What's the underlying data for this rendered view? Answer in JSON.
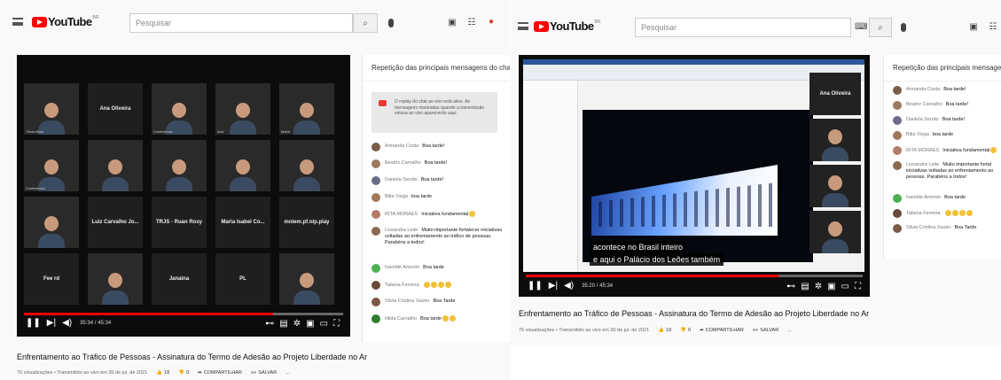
{
  "left": {
    "topbar": {
      "logo_text": "YouTube",
      "logo_sup": "BR",
      "search_placeholder": "Pesquisar"
    },
    "tiles": [
      {
        "name": "",
        "label": "Tânia Mara"
      },
      {
        "name": "Ana Oliveira",
        "label": ""
      },
      {
        "name": "",
        "label": "Conferência"
      },
      {
        "name": "",
        "label": "Ana"
      },
      {
        "name": "",
        "label": "Maria"
      },
      {
        "name": "",
        "label": "Conferência"
      },
      {
        "name": "",
        "label": ""
      },
      {
        "name": "",
        "label": ""
      },
      {
        "name": "",
        "label": ""
      },
      {
        "name": "",
        "label": ""
      },
      {
        "name": "",
        "label": ""
      },
      {
        "name": "Luiz Carvalho Jo...",
        "label": ""
      },
      {
        "name": "TRJS - Ruan Rosy",
        "label": ""
      },
      {
        "name": "Maria Isabel Co...",
        "label": ""
      },
      {
        "name": "mniem.pf.nip.play",
        "label": ""
      },
      {
        "name": "Fee rd",
        "label": ""
      },
      {
        "name": "",
        "label": ""
      },
      {
        "name": "Janaina",
        "label": ""
      },
      {
        "name": "PL",
        "label": ""
      },
      {
        "name": "",
        "label": ""
      }
    ],
    "player": {
      "time": "35:34 / 45:34",
      "progress": 0.78
    },
    "title": "Enfrentamento ao Tráfico de Pessoas - Assinatura do Termo de Adesão ao Projeto Liberdade no Ar",
    "meta": {
      "views": "76 visualizações • Transmitido ao vivo em 30 de jul. de 2021",
      "likes": "18",
      "dislikes": "0",
      "share": "COMPARTILHAR",
      "save": "SALVAR",
      "more": "..."
    },
    "chat": {
      "header": "Repetição das principais mensagens do chat",
      "notice": "O replay do chat ao vivo está ativo. As mensagens mostradas quando a transmissão estava ao vivo aparecerão aqui.",
      "messages": [
        {
          "author": "Armanda Costa",
          "text": "Boa tarde!",
          "emojis": 0,
          "avatar": "#7a5c48"
        },
        {
          "author": "Beatriz Carvalho",
          "text": "Boa tarde!",
          "emojis": 0,
          "avatar": "#9c7a60"
        },
        {
          "author": "Daniela Serrão",
          "text": "Boa tarde!",
          "emojis": 0,
          "avatar": "#6b6b8a"
        },
        {
          "author": "Bilia Viega",
          "text": "boa tarde",
          "emojis": 0,
          "avatar": "#a0785a"
        },
        {
          "author": "RITA MORAES",
          "text": "Iniciativa fundamental",
          "emojis": 1,
          "avatar": "#b07a6a"
        },
        {
          "author": "Lissandra Leite",
          "text": "Muito importante fortalecer iniciativas voltadas ao enfrentamento ao tráfico de pessoas. Parabéns a todos!",
          "emojis": 0,
          "avatar": "#8a6a50"
        },
        {
          "author": "Ivanilde Amorim",
          "text": "Boa tarde",
          "emojis": 0,
          "avatar": "#4caf50"
        },
        {
          "author": "Tatiana Ferreira",
          "text": "",
          "emojis": 4,
          "avatar": "#6a4a3a"
        },
        {
          "author": "Silvia Cristina Xavier",
          "text": "Boa Tarde",
          "emojis": 0,
          "avatar": "#7b5a48"
        },
        {
          "author": "Hilda Carvalho",
          "text": "Boa tarde",
          "emojis": 2,
          "avatar": "#2e7d32"
        }
      ]
    }
  },
  "right": {
    "topbar": {
      "logo_text": "YouTube",
      "logo_sup": "BR",
      "search_placeholder": "Pesquisar"
    },
    "side_tiles": [
      {
        "name": "Ana Oliveira"
      },
      {
        "name": ""
      },
      {
        "name": ""
      },
      {
        "name": ""
      }
    ],
    "caption_line1": "acontece no Brasil inteiro",
    "caption_line2": "e aqui o Palácio dos Leões também",
    "player": {
      "time": "35:20 / 45:34",
      "progress": 0.75
    },
    "title": "Enfrentamento ao Tráfico de Pessoas - Assinatura do Termo de Adesão ao Projeto Liberdade no Ar",
    "meta": {
      "views": "76 visualizações • Transmitido ao vivo em 30 de jul. de 2021",
      "likes": "18",
      "dislikes": "0",
      "share": "COMPARTILHAR",
      "save": "SALVAR",
      "more": "..."
    },
    "chat": {
      "header": "Repetição das principais mensagens d",
      "messages": [
        {
          "author": "Armanda Costa",
          "text": "Boa tarde!",
          "emojis": 0,
          "avatar": "#7a5c48"
        },
        {
          "author": "Beatriz Carvalho",
          "text": "Boa tarde!",
          "emojis": 0,
          "avatar": "#9c7a60"
        },
        {
          "author": "Daniela Serrão",
          "text": "Boa tarde!",
          "emojis": 0,
          "avatar": "#6b6b8a"
        },
        {
          "author": "Bilia Viega",
          "text": "boa tarde",
          "emojis": 0,
          "avatar": "#a0785a"
        },
        {
          "author": "RITA MORAES",
          "text": "Iniciativa fundamental",
          "emojis": 1,
          "avatar": "#b07a6a"
        },
        {
          "author": "Lissandra Leite",
          "text": "Muito importante fortal iniciativas voltadas ao enfrentamento ao pessoas. Parabéns a todos!",
          "emojis": 0,
          "avatar": "#8a6a50"
        },
        {
          "author": "Ivanilde Amorim",
          "text": "Boa tarde",
          "emojis": 0,
          "avatar": "#4caf50"
        },
        {
          "author": "Tatiana Ferreira",
          "text": "",
          "emojis": 4,
          "avatar": "#6a4a3a"
        },
        {
          "author": "Silvia Cristina Xavier",
          "text": "Boa Tarde",
          "emojis": 0,
          "avatar": "#7b5a48"
        }
      ]
    }
  }
}
